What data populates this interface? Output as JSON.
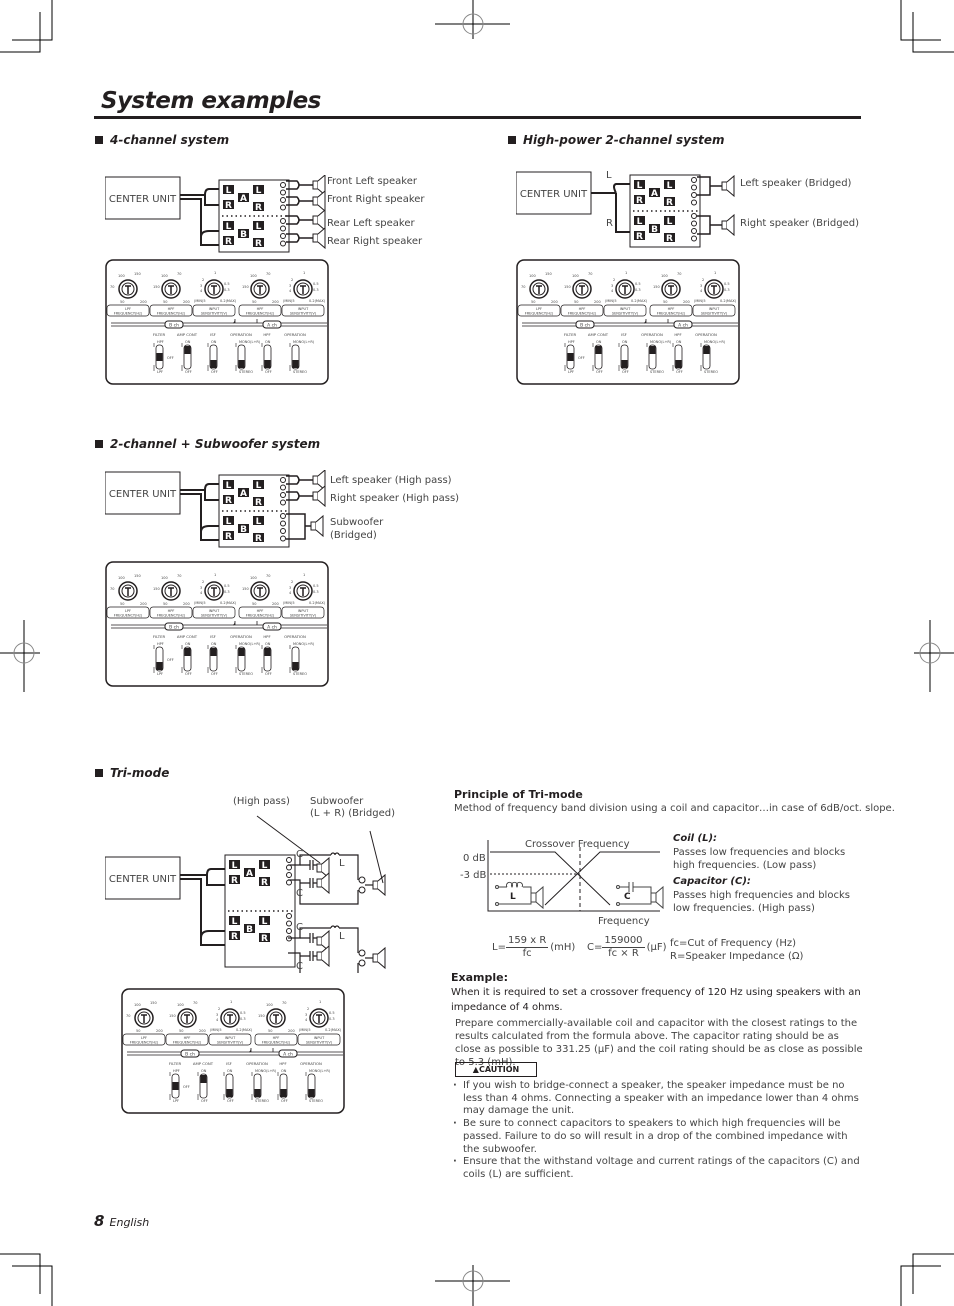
{
  "page": {
    "title": "System examples",
    "page_number": "8",
    "language": "English"
  },
  "common": {
    "center_unit": "CENTER UNIT",
    "amp_labels": {
      "L": "L",
      "R": "R",
      "A": "A",
      "B": "B"
    }
  },
  "panel": {
    "knobs": [
      {
        "ticks": [
          "100",
          "150",
          "70",
          "50",
          "200"
        ],
        "caption_1": "LPF",
        "caption_2": "FREQUENCY(Hz)"
      },
      {
        "ticks": [
          "100",
          "70",
          "150",
          "50",
          "200"
        ],
        "caption_1": "HPF",
        "caption_2": "FREQUENCY(Hz)"
      },
      {
        "ticks": [
          "1",
          "2",
          "0.5",
          "3",
          "0.3",
          "4",
          "(MIN)5",
          "0.2(MAX)"
        ],
        "caption_1": "INPUT",
        "caption_2": "SENSITIVITY(V)"
      },
      {
        "ticks": [
          "100",
          "70",
          "150",
          "50",
          "200"
        ],
        "caption_1": "HPF",
        "caption_2": "FREQUENCY(Hz)"
      },
      {
        "ticks": [
          "1",
          "2",
          "0.5",
          "3",
          "0.3",
          "4",
          "(MIN)5",
          "0.2(MAX)"
        ],
        "caption_1": "INPUT",
        "caption_2": "SENSITIVITY(V)"
      }
    ],
    "b_ch": "B ch",
    "a_ch": "A ch",
    "switches": [
      {
        "title": "FILTER",
        "top": "HPF",
        "mid": "OFF",
        "bottom": "LPF"
      },
      {
        "title": "AMP CONT",
        "top": "ON",
        "bottom": "OFF"
      },
      {
        "title": "ISF",
        "top": "ON",
        "bottom": "OFF"
      },
      {
        "title": "OPERATION",
        "top": "MONO(L+R)",
        "bottom": "STEREO"
      },
      {
        "title": "HPF",
        "top": "ON",
        "bottom": "OFF"
      },
      {
        "title": "OPERATION",
        "top": "MONO(L+R)",
        "bottom": "STEREO"
      }
    ]
  },
  "sections": {
    "four_channel": {
      "heading": "4-channel system",
      "speakers": [
        "Front Left speaker",
        "Front Right speaker",
        "Rear Left speaker",
        "Rear Right speaker"
      ],
      "switch_positions": [
        "mid",
        "top",
        "bottom",
        "bottom",
        "bottom",
        "bottom"
      ]
    },
    "high_power": {
      "heading": "High-power 2-channel system",
      "input_l": "L",
      "input_r": "R",
      "speakers": [
        "Left speaker (Bridged)",
        "Right speaker (Bridged)"
      ],
      "switch_positions": [
        "mid",
        "top",
        "bottom",
        "top",
        "bottom",
        "top"
      ]
    },
    "two_plus_sub": {
      "heading": "2-channel + Subwoofer system",
      "speakers": [
        "Left speaker (High pass)",
        "Right speaker (High pass)",
        "Subwoofer",
        "(Bridged)"
      ],
      "switch_positions": [
        "bottom",
        "top",
        "top",
        "top",
        "top",
        "bottom"
      ]
    },
    "tri_mode": {
      "heading": "Tri-mode",
      "label_high_pass": "(High pass)",
      "label_sub_1": "Subwoofer",
      "label_sub_2": "(L + R) (Bridged)",
      "cap_label": "C",
      "coil_label": "L",
      "switch_positions": [
        "mid",
        "top",
        "bottom",
        "bottom",
        "bottom",
        "bottom"
      ]
    }
  },
  "principle": {
    "heading": "Principle of Tri-mode",
    "description": "Method of frequency band division using a coil and capacitor…in case of 6dB/oct. slope.",
    "graph": {
      "title": "Crossover Frequency",
      "y_0db": "0 dB",
      "y_3db": "-3 dB",
      "x_label": "Frequency",
      "coil_symbol": "L",
      "cap_symbol": "C"
    },
    "coil_heading": "Coil (L):",
    "coil_text": "Passes low frequencies and blocks high frequencies. (Low pass)",
    "cap_heading": "Capacitor (C):",
    "cap_text": "Passes high frequencies and blocks low frequencies. (High pass)",
    "formula_l": {
      "lhs": "L=",
      "num": "159 x R",
      "den": "fc",
      "unit": "(mH)"
    },
    "formula_c": {
      "lhs": "C=",
      "num": "159000",
      "den": "fc × R",
      "unit": "(µF)"
    },
    "legend_fc": "fc=Cut of Frequency (Hz)",
    "legend_r": "R=Speaker Impedance (Ω)"
  },
  "example": {
    "heading": "Example:",
    "lead": "When it is required to set a crossover frequency of 120 Hz using speakers with an impedance of 4 ohms.",
    "body": "Prepare commercially-available coil and capacitor with the closest ratings to the results calculated from the formula above. The capacitor rating should be as close as possible to 331.25 (µF) and the coil rating should be as close as possible to 5.3 (mH).",
    "caution_label": "CAUTION",
    "cautions": [
      "If you wish to bridge-connect a speaker, the speaker impedance must be no less than 4 ohms. Connecting a speaker with an impedance lower than 4 ohms may damage the unit.",
      "Be sure to connect capacitors to speakers to which high frequencies will be passed. Failure to do so will result in a drop of the combined impedance with the subwoofer.",
      "Ensure that the withstand voltage and current ratings of the capacitors (C) and coils (L) are sufficient."
    ]
  }
}
